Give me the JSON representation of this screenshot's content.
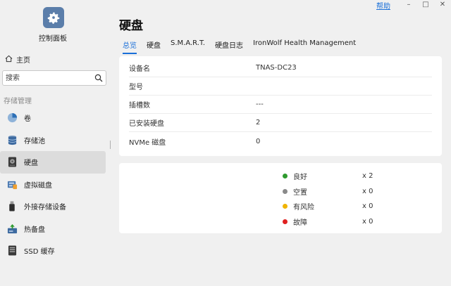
{
  "window": {
    "help": "帮助",
    "minimize": "–",
    "maximize": "□",
    "close": "✕"
  },
  "sidebar": {
    "app_title": "控制面板",
    "home": "主页",
    "search_placeholder": "搜索",
    "section": "存储管理",
    "items": [
      {
        "label": "卷",
        "icon": "volume-pie-icon",
        "active": false
      },
      {
        "label": "存储池",
        "icon": "storage-pool-icon",
        "active": false
      },
      {
        "label": "硬盘",
        "icon": "hard-disk-icon",
        "active": true
      },
      {
        "label": "虚拟磁盘",
        "icon": "virtual-disk-icon",
        "active": false
      },
      {
        "label": "外接存储设备",
        "icon": "usb-drive-icon",
        "active": false
      },
      {
        "label": "热备盘",
        "icon": "hot-spare-icon",
        "active": false
      },
      {
        "label": "SSD 缓存",
        "icon": "ssd-cache-icon",
        "active": false
      }
    ]
  },
  "main": {
    "title": "硬盘",
    "tabs": [
      "总览",
      "硬盘",
      "S.M.A.R.T.",
      "硬盘日志",
      "IronWolf Health Management"
    ],
    "info": [
      {
        "key": "设备名",
        "value": "TNAS-DC23"
      },
      {
        "key": "型号",
        "value": ""
      },
      {
        "key": "插槽数",
        "value": "---"
      },
      {
        "key": "已安装硬盘",
        "value": "2"
      },
      {
        "key": "NVMe 磁盘",
        "value": "0"
      }
    ],
    "status": [
      {
        "label": "良好",
        "count": "x 2",
        "color": "#2e9a2e"
      },
      {
        "label": "空置",
        "count": "x 0",
        "color": "#8a8a8a"
      },
      {
        "label": "有风险",
        "count": "x 0",
        "color": "#f0b400"
      },
      {
        "label": "故障",
        "count": "x 0",
        "color": "#e02020"
      }
    ]
  },
  "colors": {
    "accent": "#1a6fd8",
    "active_bg": "#dcdcdc"
  }
}
